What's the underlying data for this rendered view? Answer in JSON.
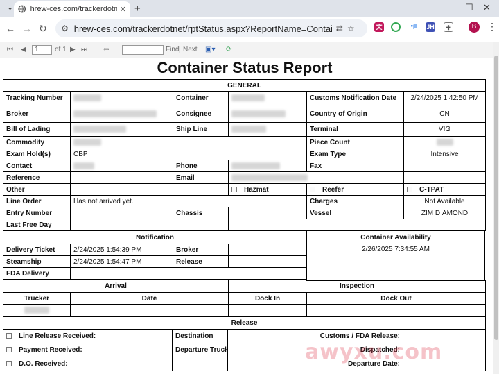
{
  "browser": {
    "tab_title": "hrew-ces.com/trackerdotnet/",
    "tab_close": "✕",
    "new_tab": "+",
    "url": "hrew-ces.com/trackerdotnet/rptStatus.aspx?ReportName=ContainerTracker&...",
    "minimize": "—",
    "maximize": "☐",
    "close": "✕",
    "avatar_letter": "B"
  },
  "viewer": {
    "first": "⏮",
    "prev": "◀",
    "page_value": "1",
    "of_label": "of 1",
    "next": "▶",
    "last": "⏭",
    "back": "⇦",
    "find_label": "Find",
    "separator": "|",
    "next_label": "Next"
  },
  "report": {
    "title": "Container Status Report",
    "general": {
      "header": "GENERAL",
      "tracking_number_label": "Tracking Number",
      "container_label": "Container",
      "customs_notification_date_label": "Customs Notification Date",
      "customs_notification_date": "2/24/2025 1:42:50 PM",
      "broker_label": "Broker",
      "consignee_label": "Consignee",
      "country_of_origin_label": "Country of Origin",
      "country_of_origin": "CN",
      "bill_of_lading_label": "Bill of Lading",
      "ship_line_label": "Ship Line",
      "terminal_label": "Terminal",
      "terminal": "VIG",
      "commodity_label": "Commodity",
      "piece_count_label": "Piece Count",
      "exam_holds_label": "Exam Hold(s)",
      "exam_holds": "CBP",
      "exam_type_label": "Exam Type",
      "exam_type": "Intensive",
      "contact_label": "Contact",
      "phone_label": "Phone",
      "fax_label": "Fax",
      "reference_label": "Reference",
      "email_label": "Email",
      "other_label": "Other",
      "hazmat_label": "Hazmat",
      "reefer_label": "Reefer",
      "ctpat_label": "C-TPAT",
      "line_order_label": "Line Order",
      "line_order": "Has not arrived yet.",
      "charges_label": "Charges",
      "charges": "Not Available",
      "entry_number_label": "Entry Number",
      "chassis_label": "Chassis",
      "vessel_label": "Vessel",
      "vessel": "ZIM DIAMOND",
      "last_free_day_label": "Last Free Day"
    },
    "notification": {
      "header": "Notification",
      "delivery_ticket_label": "Delivery Ticket",
      "delivery_ticket": "2/24/2025 1:54:39 PM",
      "broker_label": "Broker",
      "steamship_label": "Steamship",
      "steamship": "2/24/2025 1:54:47 PM",
      "release_label": "Release",
      "fda_delivery_label": "FDA Delivery"
    },
    "availability": {
      "header": "Container Availability",
      "value": "2/26/2025 7:34:55 AM"
    },
    "arrival": {
      "header": "Arrival",
      "trucker_label": "Trucker",
      "date_label": "Date"
    },
    "inspection": {
      "header": "Inspection",
      "dock_in_label": "Dock In",
      "dock_out_label": "Dock Out"
    },
    "release": {
      "header": "Release",
      "line_release_label": "Line Release Received:",
      "destination_label": "Destination",
      "customs_fda_label": "Customs / FDA Release:",
      "payment_label": "Payment Received:",
      "departure_truck_label": "Departure Truck",
      "dispatched_label": "Dispatched:",
      "do_label": "D.O. Received:",
      "departure_date_label": "Departure Date:"
    }
  },
  "colors": {
    "accent": "#1a73e8",
    "watermark": "#dc283c"
  },
  "watermark": "awyxu.com"
}
